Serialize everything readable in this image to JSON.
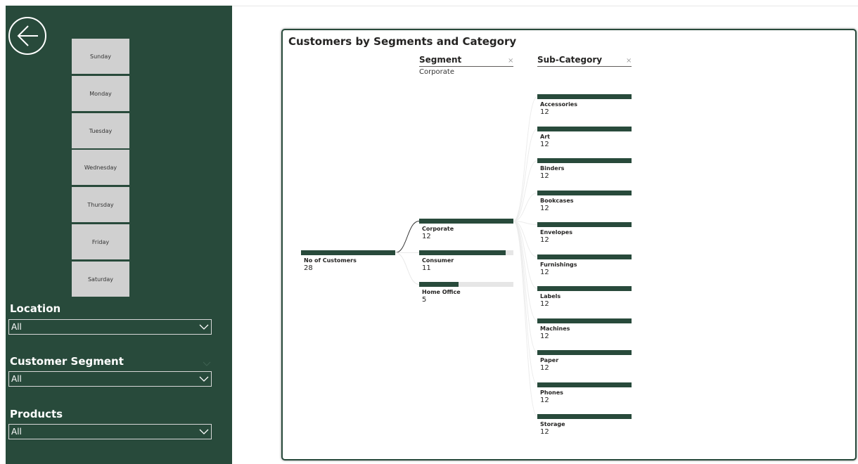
{
  "colors": {
    "sidebar_bg": "#284a3b",
    "accent": "#284a3b",
    "day_button_bg": "#d0d0d0",
    "track": "#e6e6e6"
  },
  "sidebar": {
    "back_icon": "back-arrow-icon",
    "days": [
      "Sunday",
      "Monday",
      "Tuesday",
      "Wednesday",
      "Thursday",
      "Friday",
      "Saturday"
    ],
    "slicers": [
      {
        "title": "Location",
        "value": "All",
        "icon": "chevron-down-icon"
      },
      {
        "title": "Customer Segment",
        "value": "All",
        "icon": "chevron-down-icon"
      },
      {
        "title": "Products",
        "value": "All",
        "icon": "chevron-down-icon"
      }
    ]
  },
  "visual": {
    "title": "Customers by Segments and Category",
    "segment_header": "Segment",
    "segment_selected": "Corporate",
    "subcategory_header": "Sub-Category",
    "clear_icon": "close-icon"
  },
  "chart_data": {
    "type": "decomposition-tree",
    "title": "Customers by Segments and Category",
    "root": {
      "label": "No of Customers",
      "value": 28
    },
    "levels": [
      {
        "name": "Segment",
        "selected": "Corporate",
        "nodes": [
          {
            "label": "Corporate",
            "value": 12
          },
          {
            "label": "Consumer",
            "value": 11
          },
          {
            "label": "Home Office",
            "value": 5
          }
        ]
      },
      {
        "name": "Sub-Category",
        "nodes": [
          {
            "label": "Accessories",
            "value": 12
          },
          {
            "label": "Art",
            "value": 12
          },
          {
            "label": "Binders",
            "value": 12
          },
          {
            "label": "Bookcases",
            "value": 12
          },
          {
            "label": "Envelopes",
            "value": 12
          },
          {
            "label": "Furnishings",
            "value": 12
          },
          {
            "label": "Labels",
            "value": 12
          },
          {
            "label": "Machines",
            "value": 12
          },
          {
            "label": "Paper",
            "value": 12
          },
          {
            "label": "Phones",
            "value": 12
          },
          {
            "label": "Storage",
            "value": 12
          }
        ]
      }
    ]
  }
}
